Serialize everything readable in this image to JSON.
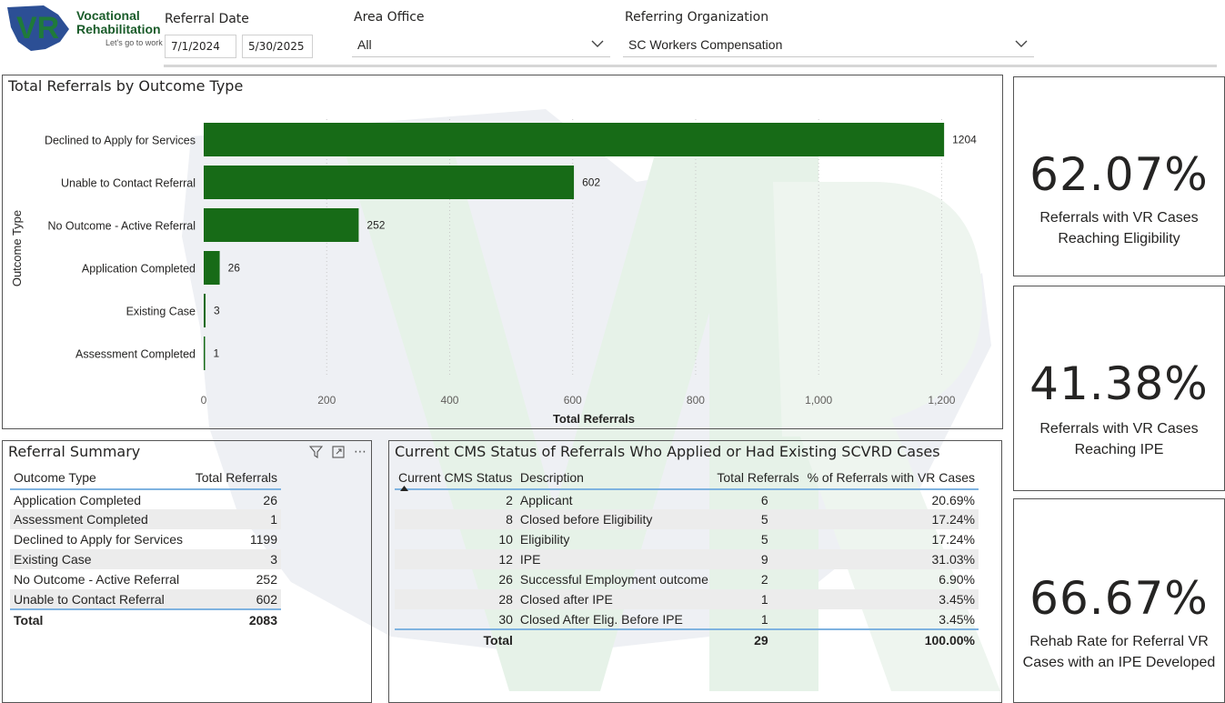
{
  "header": {
    "logo": {
      "line1": "Vocational",
      "line2": "Rehabilitation",
      "tagline": "Let's go to work",
      "mark": "VR"
    },
    "referral_date": {
      "label": "Referral Date",
      "start": "7/1/2024",
      "end": "5/30/2025"
    },
    "area_office": {
      "label": "Area Office",
      "value": "All"
    },
    "referring_org": {
      "label": "Referring Organization",
      "value": "SC Workers Compensation"
    }
  },
  "chart_panel": {
    "title": "Total Referrals by Outcome Type"
  },
  "chart_data": {
    "type": "bar",
    "orientation": "horizontal",
    "title": "Total Referrals by Outcome Type",
    "xlabel": "Total Referrals",
    "ylabel": "Outcome Type",
    "categories": [
      "Declined to Apply for Services",
      "Unable to Contact Referral",
      "No Outcome - Active Referral",
      "Application Completed",
      "Existing Case",
      "Assessment Completed"
    ],
    "values": [
      1204,
      602,
      252,
      26,
      3,
      1
    ],
    "xlim": [
      0,
      1260
    ],
    "xticks": [
      0,
      200,
      400,
      600,
      800,
      1000,
      1200
    ],
    "xtick_labels": [
      "0",
      "200",
      "400",
      "600",
      "800",
      "1,000",
      "1,200"
    ],
    "grid": "vertical dotted",
    "bar_color": "#176b17"
  },
  "summary": {
    "title": "Referral Summary",
    "columns": [
      "Outcome Type",
      "Total Referrals"
    ],
    "rows": [
      [
        "Application Completed",
        "26"
      ],
      [
        "Assessment Completed",
        "1"
      ],
      [
        "Declined to Apply for Services",
        "1199"
      ],
      [
        "Existing Case",
        "3"
      ],
      [
        "No Outcome - Active Referral",
        "252"
      ],
      [
        "Unable to Contact Referral",
        "602"
      ]
    ],
    "total": [
      "Total",
      "2083"
    ],
    "icons": [
      "filter-icon",
      "focus-mode-icon",
      "more-options-icon"
    ]
  },
  "cms": {
    "title": "Current CMS Status of Referrals Who Applied or Had Existing SCVRD Cases",
    "columns": [
      "Current CMS Status",
      "Description",
      "Total Referrals",
      "% of Referrals with VR Cases"
    ],
    "rows": [
      [
        "2",
        "Applicant",
        "6",
        "20.69%"
      ],
      [
        "8",
        "Closed before Eligibility",
        "5",
        "17.24%"
      ],
      [
        "10",
        "Eligibility",
        "5",
        "17.24%"
      ],
      [
        "12",
        "IPE",
        "9",
        "31.03%"
      ],
      [
        "26",
        "Successful Employment outcome",
        "2",
        "6.90%"
      ],
      [
        "28",
        "Closed after IPE",
        "1",
        "3.45%"
      ],
      [
        "30",
        "Closed After Elig. Before IPE",
        "1",
        "3.45%"
      ]
    ],
    "total": [
      "Total",
      "",
      "29",
      "100.00%"
    ]
  },
  "kpis": [
    {
      "value": "62.07%",
      "label_line1": "Referrals with VR Cases",
      "label_line2": "Reaching Eligibility"
    },
    {
      "value": "41.38%",
      "label_line1": "Referrals with VR Cases",
      "label_line2": "Reaching IPE"
    },
    {
      "value": "66.67%",
      "label_line1": "Rehab Rate for Referral VR",
      "label_line2": "Cases with an IPE Developed"
    }
  ],
  "colors": {
    "bar": "#176b17",
    "brand_green": "#1a5c2a",
    "brand_blue": "#2c4f95",
    "accent_rule": "#7fb3e0"
  }
}
